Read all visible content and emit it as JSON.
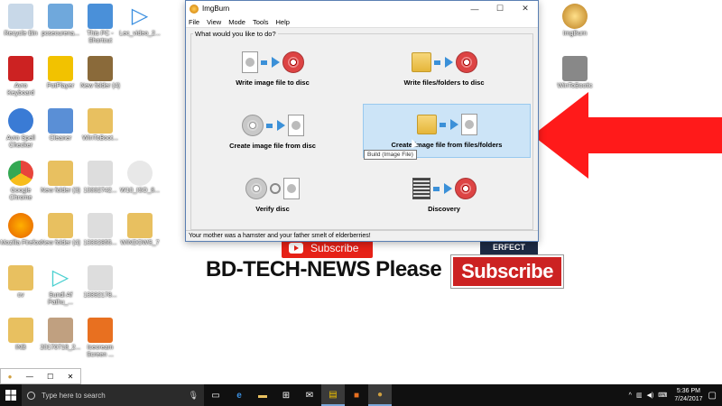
{
  "desktop": {
    "icons": [
      {
        "label": "Recycle Bin",
        "color": "#c8d8e8"
      },
      {
        "label": "pcsecurena...",
        "color": "#6fa8dc"
      },
      {
        "label": "This PC - Shortcut",
        "color": "#4a90d9"
      },
      {
        "label": "Lec_video_2...",
        "color": "#3b8fe0"
      },
      {
        "label": "Avro Keyboard",
        "color": "#cc2222"
      },
      {
        "label": "PotPlayer",
        "color": "#f2c200"
      },
      {
        "label": "New folder (4)",
        "color": "#8a6a3a"
      },
      {
        "label": "Avro Spell Checker",
        "color": "#3a7bd5"
      },
      {
        "label": "Cleaner",
        "color": "#5a8fd6"
      },
      {
        "label": "WinToBoot...",
        "color": "#e8c060"
      },
      {
        "label": "Google Chrome",
        "color": "#e8453c"
      },
      {
        "label": "New folder (3)",
        "color": "#e8c060"
      },
      {
        "label": "13332742...",
        "color": "#dddddd"
      },
      {
        "label": "W10_ISO_8...",
        "color": "#e8e8e8"
      },
      {
        "label": "Mozilla Firefox",
        "color": "#e66000"
      },
      {
        "label": "New folder (4)",
        "color": "#e8c060"
      },
      {
        "label": "13332855...",
        "color": "#dddddd"
      },
      {
        "label": "WINDOWS_7",
        "color": "#e8c060"
      },
      {
        "label": "cv",
        "color": "#e8c060"
      },
      {
        "label": "Sundi Af Pathu_...",
        "color": "#4ad0d0"
      },
      {
        "label": "13332178...",
        "color": "#dddddd"
      },
      {
        "label": "INB",
        "color": "#e8c060"
      },
      {
        "label": "20170718_2...",
        "color": "#c0a080"
      },
      {
        "label": "Icecream Screen ...",
        "color": "#e87020"
      },
      {
        "label": "ImgBurn",
        "color": "#d0a040"
      },
      {
        "label": "WinToBootic",
        "color": "#888888"
      }
    ]
  },
  "promo": {
    "small_subscribe": "Subscribe",
    "channel": "BD-TECH-NEWS Please",
    "big_subscribe": "Subscribe",
    "badge": "ERFECT"
  },
  "window": {
    "title": "ImgBurn",
    "minimize": "—",
    "maximize": "☐",
    "close": "✕",
    "menu": [
      "File",
      "View",
      "Mode",
      "Tools",
      "Help"
    ],
    "group_label": "What would you like to do?",
    "tasks": [
      {
        "label": "Write image file to disc"
      },
      {
        "label": "Write files/folders to disc"
      },
      {
        "label": "Create image file from disc"
      },
      {
        "label": "Create image file from files/folders"
      },
      {
        "label": "Verify disc"
      },
      {
        "label": "Discovery"
      }
    ],
    "tooltip": "Build (Image File)",
    "status": "Your mother was a hamster and your father smelt of elderberries!"
  },
  "taskbar": {
    "search_placeholder": "Type here to search",
    "time": "5:36 PM",
    "date": "7/24/2017"
  }
}
